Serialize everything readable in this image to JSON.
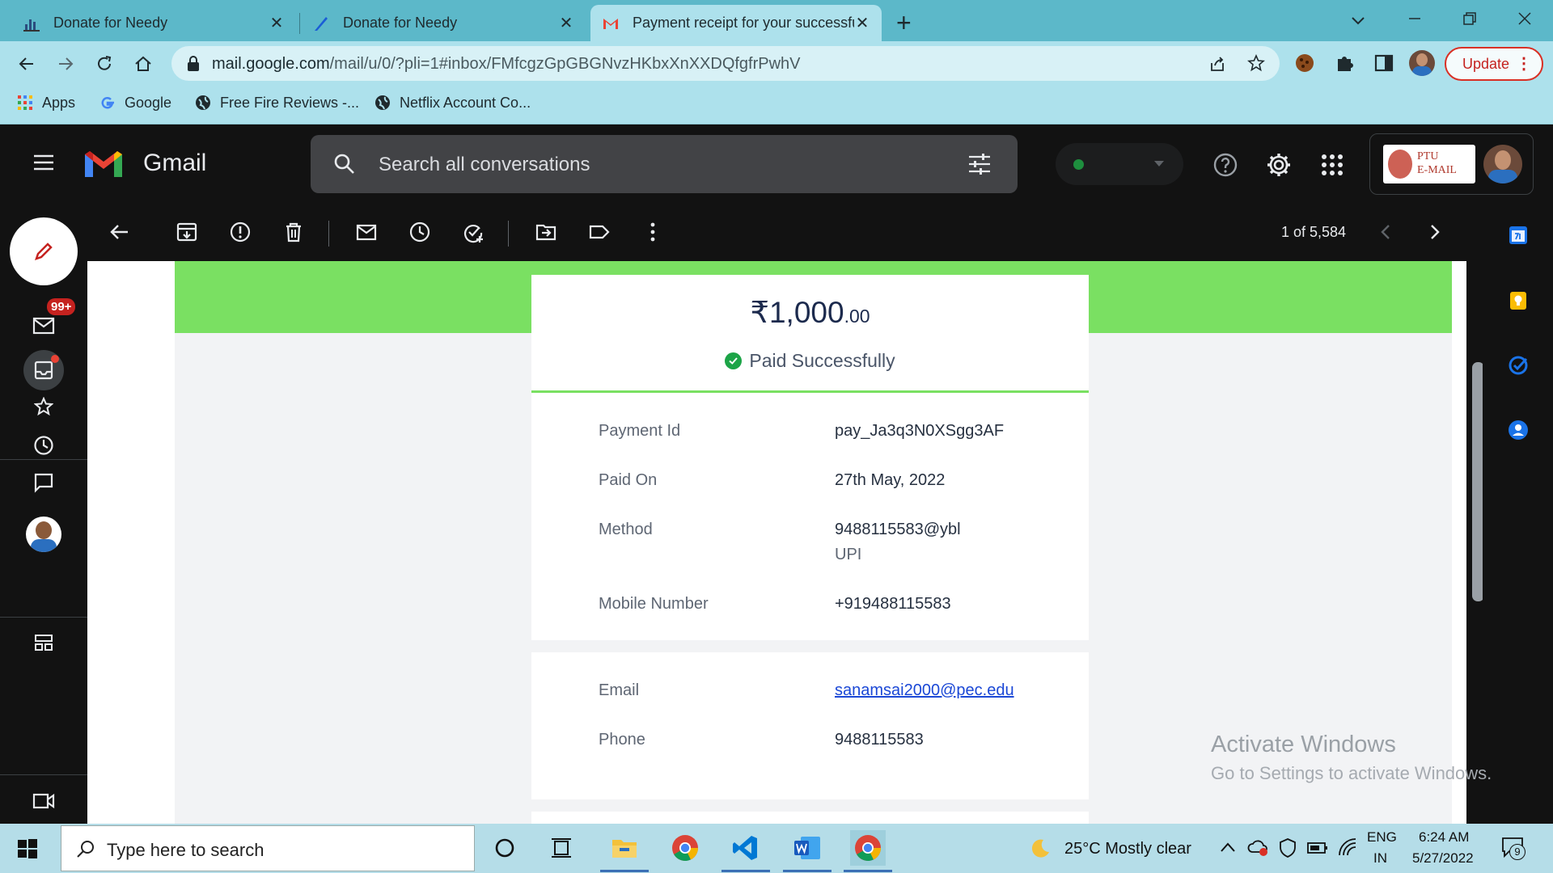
{
  "browser": {
    "tabs": [
      {
        "title": "Donate for Needy",
        "icon": "chart-favicon-icon",
        "active": false
      },
      {
        "title": "Donate for Needy",
        "icon": "pen-favicon-icon",
        "active": false
      },
      {
        "title": "Payment receipt for your successful",
        "icon": "gmail-favicon-icon",
        "active": true
      }
    ],
    "new_tab": "+",
    "address": {
      "host": "mail.google.com",
      "path": "/mail/u/0/?pli=1#inbox/FMfcgzGpGBGNvzHKbxXnXXDQfgfrPwhV"
    },
    "update_label": "Update",
    "bookmarks": [
      {
        "label": "Apps",
        "icon": "apps-grid-icon"
      },
      {
        "label": "Google",
        "icon": "google-g-icon"
      },
      {
        "label": "Free Fire Reviews -...",
        "icon": "globe-icon"
      },
      {
        "label": "Netflix Account Co...",
        "icon": "globe-icon"
      }
    ]
  },
  "gmail": {
    "brand": "Gmail",
    "search_placeholder": "Search all conversations",
    "account_logo_line1": "PTU",
    "account_logo_line2": "E-MAIL",
    "inbox_badge": "99+",
    "pagination": "1 of 5,584"
  },
  "receipt": {
    "currency": "₹",
    "amount_whole": "1,000",
    "amount_decimal": ".00",
    "status": "Paid Successfully",
    "details": [
      {
        "label": "Payment Id",
        "value": "pay_Ja3q3N0XSgg3AF"
      },
      {
        "label": "Paid On",
        "value": "27th May, 2022"
      },
      {
        "label": "Method",
        "value": "9488115583@ybl",
        "value2": "UPI"
      },
      {
        "label": "Mobile Number",
        "value": "+919488115583"
      }
    ],
    "contact": [
      {
        "label": "Email",
        "value": "sanamsai2000@pec.edu"
      },
      {
        "label": "Phone",
        "value": "9488115583"
      }
    ]
  },
  "watermark": {
    "line1": "Activate Windows",
    "line2": "Go to Settings to activate Windows."
  },
  "taskbar": {
    "search_placeholder": "Type here to search",
    "weather": "25°C  Mostly clear",
    "lang1": "ENG",
    "lang2": "IN",
    "time": "6:24 AM",
    "date": "5/27/2022",
    "notification_count": "9"
  },
  "colors": {
    "gmail_red": "#ea4335",
    "receipt_green": "#7ae062",
    "link_blue": "#1a47d6",
    "chrome_teal": "#5cb8c9"
  }
}
